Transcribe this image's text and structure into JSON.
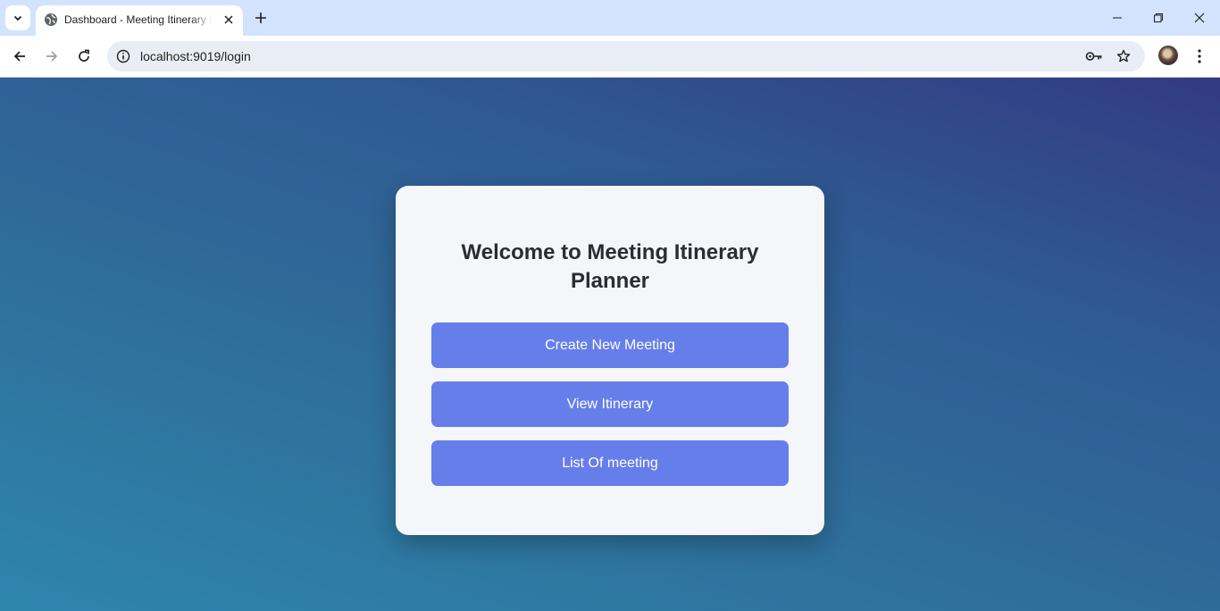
{
  "browser": {
    "tab_title": "Dashboard - Meeting Itinerary Planner",
    "url": "localhost:9019/login"
  },
  "icons": {
    "tab_search": "chevron-down-icon",
    "favicon": "globe-icon",
    "tab_close": "close-icon",
    "new_tab": "plus-icon",
    "minimize": "minimize-icon",
    "restore": "restore-icon",
    "close_window": "close-icon",
    "back": "arrow-left-icon",
    "forward": "arrow-right-icon",
    "reload": "reload-icon",
    "site_info": "info-icon",
    "password": "key-icon",
    "bookmark": "star-icon",
    "menu": "kebab-menu-icon"
  },
  "colors": {
    "tabstrip": "#d3e3fd",
    "page_gradient_start": "#2e86ad",
    "page_gradient_end": "#333a82",
    "card": "#f4f6fa",
    "button": "#667eea",
    "heading": "#2a2d33"
  },
  "dashboard": {
    "heading": "Welcome to Meeting Itinerary Planner",
    "buttons": {
      "create": "Create New Meeting",
      "view": "View Itinerary",
      "list": "List Of meeting"
    }
  }
}
